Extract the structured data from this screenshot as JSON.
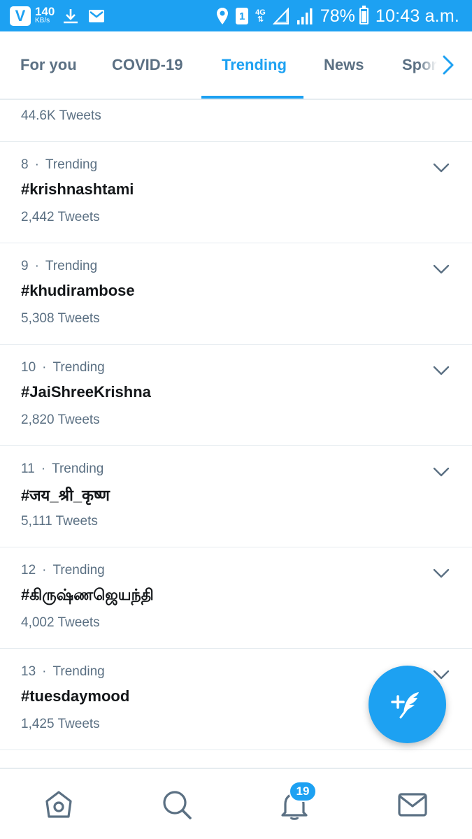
{
  "status_bar": {
    "app_letter": "V",
    "speed_value": "140",
    "speed_unit": "KB/s",
    "sim_slot": "1",
    "network_type": "4G",
    "battery_percent": "78%",
    "battery_level": 0.78,
    "time": "10:43 a.m."
  },
  "tabs": [
    {
      "label": "For you"
    },
    {
      "label": "COVID-19"
    },
    {
      "label": "Trending"
    },
    {
      "label": "News"
    },
    {
      "label": "Sports"
    }
  ],
  "active_tab": "Trending",
  "partial_top_item": {
    "tweets": "44.6K Tweets"
  },
  "trends": [
    {
      "rank": "8",
      "category": "Trending",
      "name": "#krishnashtami",
      "tweets": "2,442 Tweets"
    },
    {
      "rank": "9",
      "category": "Trending",
      "name": "#khudirambose",
      "tweets": "5,308 Tweets"
    },
    {
      "rank": "10",
      "category": "Trending",
      "name": "#JaiShreeKrishna",
      "tweets": "2,820 Tweets"
    },
    {
      "rank": "11",
      "category": "Trending",
      "name": "#जय_श्री_कृष्ण",
      "tweets": "5,111 Tweets"
    },
    {
      "rank": "12",
      "category": "Trending",
      "name": "#கிருஷ்ணஜெயந்தி",
      "tweets": "4,002 Tweets"
    },
    {
      "rank": "13",
      "category": "Trending",
      "name": "#tuesdaymood",
      "tweets": "1,425 Tweets"
    }
  ],
  "separator": "·",
  "notifications_badge": "19",
  "colors": {
    "accent": "#1da1f2",
    "text_primary": "#14171a",
    "text_secondary": "#5b7083",
    "divider": "#e6ecf0"
  },
  "icons": {
    "fab": "compose-tweet-icon",
    "nav": [
      "home-icon",
      "search-icon",
      "notifications-bell-icon",
      "messages-envelope-icon"
    ]
  }
}
